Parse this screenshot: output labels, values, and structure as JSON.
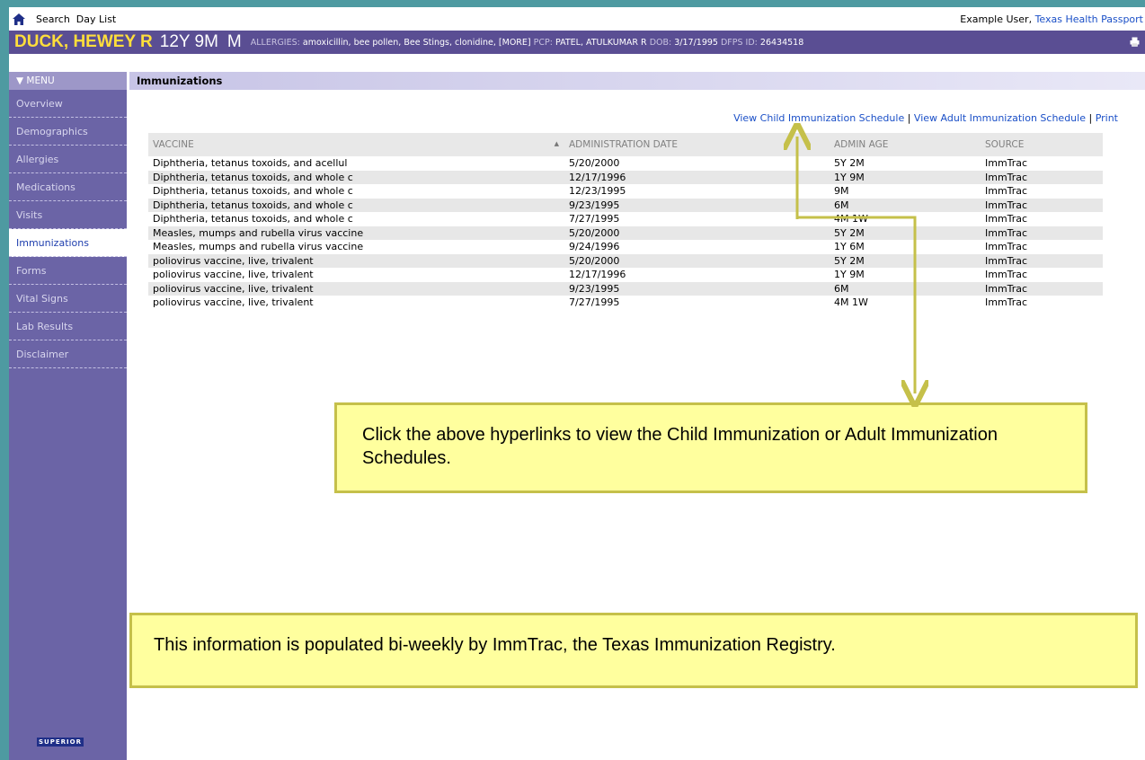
{
  "topbar": {
    "home_icon": "home-icon",
    "search_label": "Search",
    "daylist_label": "Day List",
    "user_name": "Example User,",
    "org_link": "Texas Health Passport"
  },
  "patient": {
    "name": "DUCK, HEWEY R",
    "age": "12Y 9M",
    "sex": "M",
    "allergies_label": "ALLERGIES:",
    "allergies_value": "amoxicillin, bee pollen, Bee Stings, clonidine, [MORE]",
    "pcp_label": "PCP:",
    "pcp_value": "PATEL, ATULKUMAR R",
    "dob_label": "DOB:",
    "dob_value": "3/17/1995",
    "dfps_label": "DFPS ID:",
    "dfps_value": "26434518",
    "print_icon": "printer-icon"
  },
  "menu": {
    "header": "▼ MENU",
    "items": [
      {
        "label": "Overview"
      },
      {
        "label": "Demographics"
      },
      {
        "label": "Allergies"
      },
      {
        "label": "Medications"
      },
      {
        "label": "Visits"
      },
      {
        "label": "Immunizations",
        "active": true
      },
      {
        "label": "Forms"
      },
      {
        "label": "Vital Signs"
      },
      {
        "label": "Lab Results"
      },
      {
        "label": "Disclaimer"
      }
    ]
  },
  "section_title": "Immunizations",
  "links": {
    "child": "View Child Immunization Schedule",
    "sep1": " | ",
    "adult": "View Adult Immunization Schedule",
    "sep2": " | ",
    "print": "Print"
  },
  "table": {
    "headers": [
      "VACCINE",
      "ADMINISTRATION DATE",
      "ADMIN AGE",
      "SOURCE"
    ],
    "sort_icon": "sort-ascending-icon",
    "rows": [
      [
        "Diphtheria, tetanus toxoids, and acellul",
        "5/20/2000",
        "5Y 2M",
        "ImmTrac"
      ],
      [
        "Diphtheria, tetanus toxoids, and whole c",
        "12/17/1996",
        "1Y 9M",
        "ImmTrac"
      ],
      [
        "Diphtheria, tetanus toxoids, and whole c",
        "12/23/1995",
        "9M",
        "ImmTrac"
      ],
      [
        "Diphtheria, tetanus toxoids, and whole c",
        "9/23/1995",
        "6M",
        "ImmTrac"
      ],
      [
        "Diphtheria, tetanus toxoids, and whole c",
        "7/27/1995",
        "4M 1W",
        "ImmTrac"
      ],
      [
        "Measles, mumps and rubella virus vaccine",
        "5/20/2000",
        "5Y 2M",
        "ImmTrac"
      ],
      [
        "Measles, mumps and rubella virus vaccine",
        "9/24/1996",
        "1Y 6M",
        "ImmTrac"
      ],
      [
        "poliovirus vaccine, live, trivalent",
        "5/20/2000",
        "5Y 2M",
        "ImmTrac"
      ],
      [
        "poliovirus vaccine, live, trivalent",
        "12/17/1996",
        "1Y 9M",
        "ImmTrac"
      ],
      [
        "poliovirus vaccine, live, trivalent",
        "9/23/1995",
        "6M",
        "ImmTrac"
      ],
      [
        "poliovirus vaccine, live, trivalent",
        "7/27/1995",
        "4M 1W",
        "ImmTrac"
      ]
    ]
  },
  "callouts": {
    "hyperlinks_note": "Click the above hyperlinks to view the Child Immunization or Adult Immunization Schedules.",
    "registry_note": "This information is populated bi-weekly by ImmTrac, the Texas Immunization Registry."
  },
  "logo_text": "SUPERIOR",
  "colors": {
    "header_purple": "#5a4e93",
    "sidebar_purple": "#6b64a6",
    "name_yellow": "#ffde3b",
    "link_blue": "#1a4fc7",
    "callout_fill": "#ffff9e",
    "callout_border": "#c5c04a",
    "frame_teal": "#4e9aa1"
  }
}
